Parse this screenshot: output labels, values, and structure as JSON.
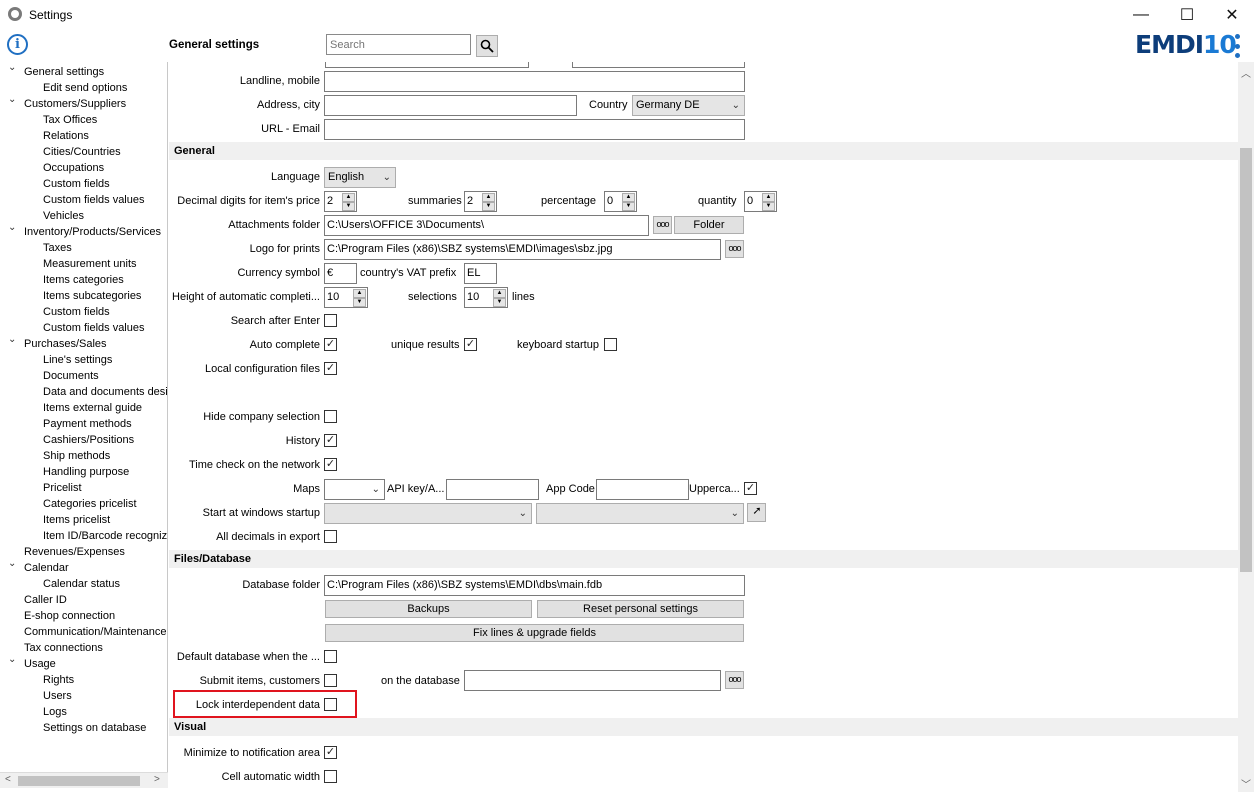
{
  "window": {
    "title": "Settings",
    "minimize": "—",
    "maximize": "☐",
    "close": "✕"
  },
  "header": {
    "title": "General settings",
    "search_placeholder": "Search",
    "logo_a": "EMDI",
    "logo_b": "10"
  },
  "sidebar": {
    "items": [
      {
        "label": "General settings",
        "level": 0,
        "toggle": "⌄"
      },
      {
        "label": "Edit send options",
        "level": 1
      },
      {
        "label": "Customers/Suppliers",
        "level": 0,
        "toggle": "⌄"
      },
      {
        "label": "Tax Offices",
        "level": 1
      },
      {
        "label": "Relations",
        "level": 1
      },
      {
        "label": "Cities/Countries",
        "level": 1
      },
      {
        "label": "Occupations",
        "level": 1
      },
      {
        "label": "Custom fields",
        "level": 1
      },
      {
        "label": "Custom fields values",
        "level": 1
      },
      {
        "label": "Vehicles",
        "level": 1
      },
      {
        "label": "Inventory/Products/Services",
        "level": 0,
        "toggle": "⌄"
      },
      {
        "label": "Taxes",
        "level": 1
      },
      {
        "label": "Measurement units",
        "level": 1
      },
      {
        "label": "Items categories",
        "level": 1
      },
      {
        "label": "Items subcategories",
        "level": 1
      },
      {
        "label": "Custom fields",
        "level": 1
      },
      {
        "label": "Custom fields values",
        "level": 1
      },
      {
        "label": "Purchases/Sales",
        "level": 0,
        "toggle": "⌄"
      },
      {
        "label": "Line's settings",
        "level": 1
      },
      {
        "label": "Documents",
        "level": 1
      },
      {
        "label": "Data and documents desi",
        "level": 1
      },
      {
        "label": "Items external guide",
        "level": 1
      },
      {
        "label": "Payment methods",
        "level": 1
      },
      {
        "label": "Cashiers/Positions",
        "level": 1
      },
      {
        "label": "Ship methods",
        "level": 1
      },
      {
        "label": "Handling purpose",
        "level": 1
      },
      {
        "label": "Pricelist",
        "level": 1
      },
      {
        "label": "Categories pricelist",
        "level": 1
      },
      {
        "label": "Items pricelist",
        "level": 1
      },
      {
        "label": "Item ID/Barcode recognize",
        "level": 1
      },
      {
        "label": "Revenues/Expenses",
        "level": 0
      },
      {
        "label": "Calendar",
        "level": 0,
        "toggle": "⌄"
      },
      {
        "label": "Calendar status",
        "level": 1
      },
      {
        "label": "Caller ID",
        "level": 0
      },
      {
        "label": "E-shop connection",
        "level": 0
      },
      {
        "label": "Communication/Maintenance",
        "level": 0
      },
      {
        "label": "Tax connections",
        "level": 0
      },
      {
        "label": "Usage",
        "level": 0,
        "toggle": "⌄"
      },
      {
        "label": "Rights",
        "level": 1
      },
      {
        "label": "Users",
        "level": 1
      },
      {
        "label": "Logs",
        "level": 1
      },
      {
        "label": "Settings on database",
        "level": 1
      }
    ]
  },
  "contact": {
    "landline_label": "Landline, mobile",
    "address_label": "Address, city",
    "country_label": "Country",
    "country_value": "Germany DE",
    "url_label": "URL - Email"
  },
  "general": {
    "section": "General",
    "language_label": "Language",
    "language_value": "English",
    "decimal_label": "Decimal digits for item's price",
    "decimal_value": "2",
    "summaries_label": "summaries",
    "summaries_value": "2",
    "percentage_label": "percentage",
    "percentage_value": "0",
    "quantity_label": "quantity",
    "quantity_value": "0",
    "attach_label": "Attachments folder",
    "attach_value": "C:\\Users\\OFFICE 3\\Documents\\",
    "folder_btn": "Folder",
    "logo_label": "Logo for prints",
    "logo_value": "C:\\Program Files (x86)\\SBZ systems\\EMDI\\images\\sbz.jpg",
    "currency_label": "Currency symbol",
    "currency_value": "€",
    "vat_label": "country's VAT prefix",
    "vat_value": "EL",
    "height_label": "Height of automatic completi...",
    "height_value": "10",
    "selections_label": "selections",
    "selections_value": "10",
    "lines_label": "lines",
    "search_enter_label": "Search after Enter",
    "auto_complete_label": "Auto complete",
    "unique_label": "unique results",
    "keyboard_label": "keyboard startup",
    "local_config_label": "Local configuration files",
    "hide_company_label": "Hide company selection",
    "history_label": "History",
    "time_check_label": "Time check on the network",
    "maps_label": "Maps",
    "api_label": "API key/A...",
    "app_code_label": "App Code",
    "upper_label": "Upperca...",
    "startup_label": "Start at windows startup",
    "all_decimals_label": "All decimals in export",
    "check": "✓"
  },
  "files": {
    "section": "Files/Database",
    "db_folder_label": "Database folder",
    "db_folder_value": "C:\\Program Files (x86)\\SBZ systems\\EMDI\\dbs\\main.fdb",
    "backups_btn": "Backups",
    "reset_btn": "Reset personal settings",
    "fix_btn": "Fix lines & upgrade fields",
    "default_db_label": "Default database when the ...",
    "submit_label": "Submit items, customers",
    "on_db_label": "on the database",
    "lock_label": "Lock interdependent data"
  },
  "visual": {
    "section": "Visual",
    "minimize_label": "Minimize to notification area",
    "cell_width_label": "Cell automatic width"
  },
  "colors": {
    "accent": "#1f6fc2",
    "highlight": "#e0141e"
  }
}
